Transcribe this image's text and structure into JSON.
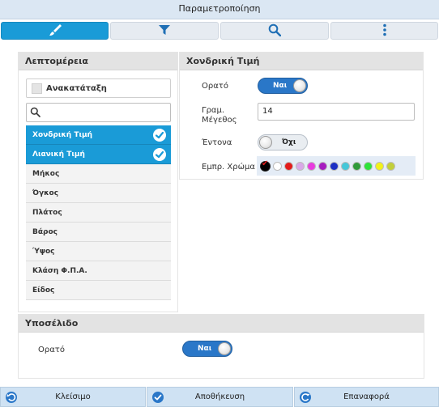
{
  "window": {
    "title": "Παραμετροποίηση"
  },
  "tabs": [
    {
      "name": "brush",
      "icon": "paintbrush-icon",
      "active": true
    },
    {
      "name": "filter",
      "icon": "filter-icon",
      "active": false
    },
    {
      "name": "search",
      "icon": "search-icon",
      "active": false
    },
    {
      "name": "more",
      "icon": "more-vertical-icon",
      "active": false
    }
  ],
  "details_panel": {
    "title": "Λεπτομέρεια",
    "shuffle_label": "Ανακατάταξη",
    "search_value": "",
    "items": [
      {
        "label": "Χονδρική Τιμή",
        "selected": true
      },
      {
        "label": "Λιανική Τιμή",
        "selected": true
      },
      {
        "label": "Μήκος",
        "selected": false
      },
      {
        "label": "Όγκος",
        "selected": false
      },
      {
        "label": "Πλάτος",
        "selected": false
      },
      {
        "label": "Βάρος",
        "selected": false
      },
      {
        "label": "Ύψος",
        "selected": false
      },
      {
        "label": "Κλάση Φ.Π.Α.",
        "selected": false
      },
      {
        "label": "Είδος",
        "selected": false
      }
    ]
  },
  "field_panel": {
    "title": "Χονδρική Τιμή",
    "visible_label": "Ορατό",
    "visible_value": "Ναι",
    "font_size_label": "Γραμ. Μέγεθος",
    "font_size_value": "14",
    "bold_label": "Έντονα",
    "bold_value": "Όχι",
    "color_label": "Εμπρ. Χρώμα",
    "colors": [
      "#000000",
      "#ffffff",
      "#e31b1b",
      "#d9a8e8",
      "#e83bdf",
      "#a61cc0",
      "#1c2fc4",
      "#45c7d9",
      "#2f9a3a",
      "#2fe33a",
      "#f2f21a",
      "#c2cf3a"
    ],
    "selected_color": "#000000"
  },
  "footer_panel": {
    "title": "Υποσέλιδο",
    "visible_label": "Ορατό",
    "visible_value": "Ναι"
  },
  "bottom_bar": {
    "close_label": "Κλείσιμο",
    "save_label": "Αποθήκευση",
    "reset_label": "Επαναφορά"
  }
}
